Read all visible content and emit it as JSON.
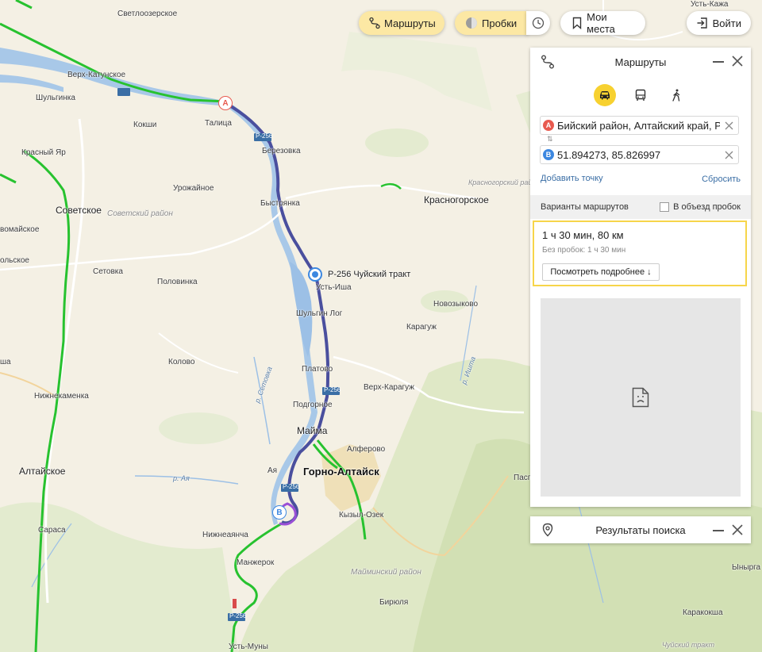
{
  "map": {
    "labels": {
      "svetloozerskoe": "Светлоозерское",
      "ust_kazha": "Усть-Кажа",
      "verkh_katunskoe": "Верх-Катунское",
      "shulginka": "Шульгинка",
      "kokshi": "Кокши",
      "talitsa": "Талица",
      "berezovka": "Березовка",
      "krasny_yar": "Красный Яр",
      "urozhaynoe": "Урожайное",
      "bystryanka": "Быстрянка",
      "sovetskoe": "Советское",
      "sovetsky_rayon": "Советский район",
      "krasnogorskoe": "Красногорское",
      "krasnogorsky_rayon": "Красногорский район",
      "vomayskoe": "вомайское",
      "olskoe": "ольское",
      "setovka": "Сетовка",
      "polovinka": "Половинка",
      "ust_isha": "Усть-Иша",
      "novozykovo": "Новозыково",
      "shulgin_log": "Шульгин Лог",
      "karaguzh": "Карагуж",
      "kolovo": "Колово",
      "platovo": "Платово",
      "verkh_karaguzh": "Верх-Карагуж",
      "nizhnekamenka": "Нижнекаменка",
      "podgornoe": "Подгорное",
      "mayma": "Майма",
      "alferovo": "Алферово",
      "gorno_altaysk": "Горно-Алтайск",
      "altayskoe": "Алтайское",
      "aya": "Ая",
      "kyzyl_ozek": "Кызыл-Озек",
      "sarasa": "Сараса",
      "nizhnyaya_aya": "Нижнеаянча",
      "manzherok": "Манжерок",
      "mayminsky_rayon": "Майминский район",
      "biryulya": "Бирюля",
      "karakoksha": "Каракокша",
      "ust_muny": "Усть-Муны",
      "chuysky_trakt_marker": "Р-256 Чуйский тракт",
      "r_setovka": "р. Сетовка",
      "r_aya": "р. Ая",
      "r_isha": "р. Ишта",
      "pasp": "Пасп",
      "ynyrga": "Ынырга",
      "chuysky_trakt_corner": "Чуйский тракт",
      "cha": "ша",
      "road_p256": "Р-256"
    },
    "marker_a": "A",
    "marker_b": "B"
  },
  "toolbar": {
    "routes_label": "Маршруты",
    "traffic_label": "Пробки",
    "my_places_label": "Мои места",
    "login_label": "Войти"
  },
  "routes_panel": {
    "title": "Маршруты",
    "from_badge": "A",
    "from_value": "Бийский район, Алтайский край, Р",
    "to_badge": "B",
    "to_value": "51.894273, 85.826997",
    "add_point": "Добавить точку",
    "reset": "Сбросить",
    "variants_label": "Варианты маршрутов",
    "avoid_traffic_label": "В объезд пробок",
    "route_summary": "1 ч 30 мин, 80 км",
    "route_no_traffic": "Без пробок: 1 ч 30 мин",
    "details_button": "Посмотреть подробнее ↓"
  },
  "search_panel": {
    "title": "Результаты поиска"
  },
  "colors": {
    "route": "#4a4f9e",
    "traffic_green": "#27c22f",
    "accent_yellow": "#fce8a4",
    "badge_red": "#e85a4f",
    "badge_blue": "#3c87e0"
  }
}
